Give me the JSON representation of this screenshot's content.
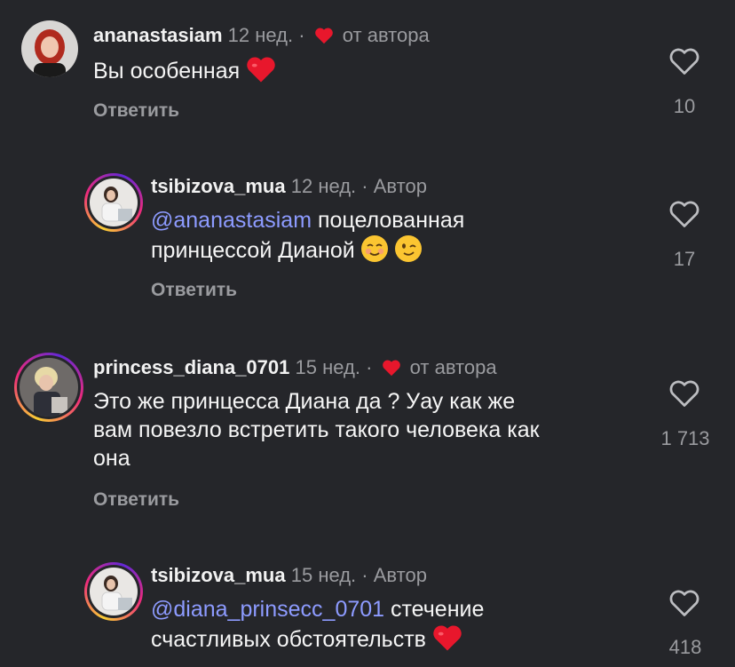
{
  "comments": [
    {
      "username": "ananastasiam",
      "time": "12 нед.",
      "sep": "·",
      "badge": "от автора",
      "text": "Вы особенная",
      "reply_label": "Ответить",
      "likes": "10"
    },
    {
      "username": "tsibizova_mua",
      "time": "12 нед.",
      "sep": "·",
      "badge": "Автор",
      "mention": "@ananastasiam",
      "text_line1": "поцелованная",
      "text_line2": "принцессой Дианой",
      "reply_label": "Ответить",
      "likes": "17"
    },
    {
      "username": "princess_diana_0701",
      "time": "15 нед.",
      "sep": "·",
      "badge": "от автора",
      "text_line1": "Это же принцесса Диана да ? Уау как же",
      "text_line2": "вам повезло встретить такого человека как",
      "text_line3": "она",
      "reply_label": "Ответить",
      "likes": "1 713"
    },
    {
      "username": "tsibizova_mua",
      "time": "15 нед.",
      "sep": "·",
      "badge": "Автор",
      "mention": "@diana_prinsecc_0701",
      "text_line1": "стечение",
      "text_line2": "счастливых обстоятельств",
      "likes": "418"
    }
  ],
  "icons": {
    "like": "heart-outline-icon",
    "liked_by_author": "heart-filled-icon",
    "emoji_heart": "red-heart-emoji",
    "emoji_smile": "smiling-face-emoji",
    "emoji_wink": "winking-face-emoji"
  },
  "colors": {
    "background": "#25262a",
    "mention": "#8d9bff",
    "heart": "#e8172c",
    "muted": "#9a9b9f"
  }
}
